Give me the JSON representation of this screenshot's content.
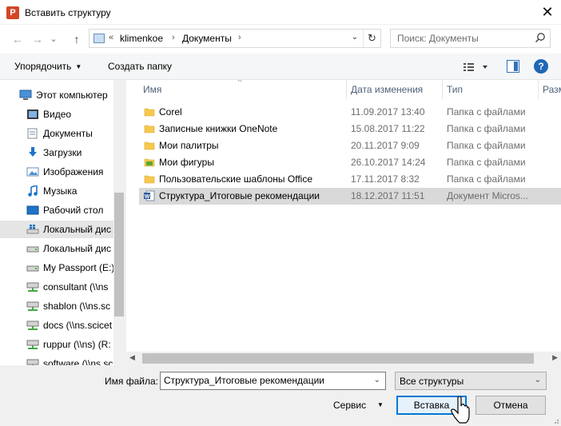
{
  "window": {
    "title": "Вставить структуру",
    "close_glyph": "✕"
  },
  "nav": {
    "back_glyph": "←",
    "forward_glyph": "→",
    "history_glyph": "⌄",
    "up_glyph": "↑",
    "breadcrumbs": [
      "klimenkoe",
      "Документы"
    ],
    "overflow": "«",
    "sep": "›",
    "dropdown_glyph": "⌄",
    "refresh_glyph": "↻",
    "search_placeholder": "Поиск: Документы"
  },
  "toolbar": {
    "organize": "Упорядочить",
    "new_folder": "Создать папку",
    "caret": "▼",
    "help": "?"
  },
  "sidebar": {
    "items": [
      {
        "label": "Этот компьютер",
        "icon": "computer-icon",
        "top": true
      },
      {
        "label": "Видео",
        "icon": "video-icon"
      },
      {
        "label": "Документы",
        "icon": "documents-icon"
      },
      {
        "label": "Загрузки",
        "icon": "downloads-icon"
      },
      {
        "label": "Изображения",
        "icon": "pictures-icon"
      },
      {
        "label": "Музыка",
        "icon": "music-icon"
      },
      {
        "label": "Рабочий стол",
        "icon": "desktop-icon"
      },
      {
        "label": "Локальный дис",
        "icon": "drive-windows-icon",
        "selected": true
      },
      {
        "label": "Локальный дис",
        "icon": "drive-icon"
      },
      {
        "label": "My Passport (E:)",
        "icon": "drive-icon"
      },
      {
        "label": "consultant (\\\\ns",
        "icon": "network-drive-icon"
      },
      {
        "label": "shablon (\\\\ns.sc",
        "icon": "network-drive-icon"
      },
      {
        "label": "docs (\\\\ns.scicet",
        "icon": "network-drive-icon"
      },
      {
        "label": "ruppur (\\\\ns) (R:",
        "icon": "network-drive-icon"
      },
      {
        "label": "software (\\\\ns.sc",
        "icon": "network-drive-icon"
      }
    ]
  },
  "filelist": {
    "columns": [
      "Имя",
      "Дата изменения",
      "Тип",
      "Разм"
    ],
    "sort_glyph": "^",
    "rows": [
      {
        "name": "Corel",
        "date": "11.09.2017 13:40",
        "type": "Папка с файлами",
        "icon": "folder-icon"
      },
      {
        "name": "Записные книжки OneNote",
        "date": "15.08.2017 11:22",
        "type": "Папка с файлами",
        "icon": "folder-icon"
      },
      {
        "name": "Мои палитры",
        "date": "20.11.2017 9:09",
        "type": "Папка с файлами",
        "icon": "folder-icon"
      },
      {
        "name": "Мои фигуры",
        "date": "26.10.2017 14:24",
        "type": "Папка с файлами",
        "icon": "shapes-folder-icon"
      },
      {
        "name": "Пользовательские шаблоны Office",
        "date": "17.11.2017 8:32",
        "type": "Папка с файлами",
        "icon": "folder-icon"
      },
      {
        "name": "Структура_Итоговые рекомендации",
        "date": "18.12.2017 11:51",
        "type": "Документ Micros...",
        "icon": "word-doc-icon",
        "selected": true
      }
    ],
    "scroll_left": "◀",
    "scroll_right": "▶"
  },
  "bottom": {
    "filename_label": "Имя файла:",
    "filename_value": "Структура_Итоговые рекомендации",
    "filetype_value": "Все структуры",
    "dropdown_glyph": "⌄",
    "service_label": "Сервис",
    "service_caret": "▼",
    "insert_label": "Вставка",
    "cancel_label": "Отмена"
  },
  "colors": {
    "accent": "#0078d7",
    "folder": "#f6c94c",
    "word": "#2b579a",
    "ppt": "#d24726"
  }
}
